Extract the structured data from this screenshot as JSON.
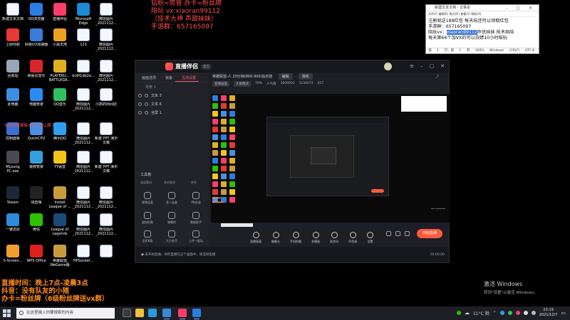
{
  "desktop_icons": [
    {
      "label": "新建文本文档",
      "color": "#ffffff",
      "doc": true
    },
    {
      "label": "QQ浏览器",
      "color": "#2a7de1"
    },
    {
      "label": "直播伴侣",
      "color": "#ff3d6a"
    },
    {
      "label": "Microsoft Edge",
      "color": "#1c8ad6"
    },
    {
      "label": "微信图片_2021112...",
      "color": "#ffffff",
      "doc": true
    },
    {
      "label": "上网导航",
      "color": "#e53935"
    },
    {
      "label": "网易UU加速器",
      "color": "#3b7bd9"
    },
    {
      "label": "小黑无用",
      "color": "#f0a020"
    },
    {
      "label": "123",
      "color": "#ffffff",
      "doc": true
    },
    {
      "label": "微信图片_2021112...",
      "color": "#ffffff",
      "doc": true
    },
    {
      "label": "回收站",
      "color": "#9aa6b8"
    },
    {
      "label": "网易云音乐",
      "color": "#d8262f"
    },
    {
      "label": "PLAYERU... BATTLEGR...",
      "color": "#e0b020"
    },
    {
      "label": "bc6f1db2e...",
      "color": "#ffffff",
      "doc": true
    },
    {
      "label": "微信图片_2021112...",
      "color": "#ffffff",
      "doc": true
    },
    {
      "label": "此电脑",
      "color": "#3d8ee0"
    },
    {
      "label": "电脑管家",
      "color": "#2a8cf0"
    },
    {
      "label": "QQ音乐",
      "color": "#30c060"
    },
    {
      "label": "微信图片_2021112...",
      "color": "#ffffff",
      "doc": true
    },
    {
      "label": "小抓的周间店",
      "color": "#ffffff",
      "doc": true
    },
    {
      "label": "控制面板",
      "color": "#3b6fd1"
    },
    {
      "label": "QuickCPU",
      "color": "#4a90e2"
    },
    {
      "label": "腾讯QQ",
      "color": "#2fa0f0"
    },
    {
      "label": "微信图片_2021112...",
      "color": "#ffffff",
      "doc": true
    },
    {
      "label": "新建 PPT 演示文稿",
      "color": "#ffffff",
      "doc": true
    },
    {
      "label": "MLoong PC.exe",
      "color": "#4a4a55"
    },
    {
      "label": "装修管家",
      "color": "#33a0e0"
    },
    {
      "label": "YY语音",
      "color": "#f5c518"
    },
    {
      "label": "微信图片_2021112...",
      "color": "#ffffff",
      "doc": true
    },
    {
      "label": "新建 PPT 演示文稿",
      "color": "#ffffff",
      "doc": true
    },
    {
      "label": "Steam",
      "color": "#1b2838"
    },
    {
      "label": "快剪辑",
      "color": "#222222"
    },
    {
      "label": "Install League of ...",
      "color": "#c89b3c"
    },
    {
      "label": "微信图片_2021112...",
      "color": "#ffffff",
      "doc": true
    },
    {
      "label": "微信图片_2021112...",
      "color": "#ffffff",
      "doc": true
    },
    {
      "label": "一键还原",
      "color": "#2d8bd8"
    },
    {
      "label": "微信",
      "color": "#2dc100"
    },
    {
      "label": "League of Legends",
      "color": "#1a4a7a"
    },
    {
      "label": "微信图片_2021112...",
      "color": "#ffffff",
      "doc": true
    },
    {
      "label": "微信图片_2021112...",
      "color": "#ffffff",
      "doc": true
    },
    {
      "label": "S-Screen...",
      "color": "#f0a030"
    },
    {
      "label": "WPS Office",
      "color": "#e02020"
    },
    {
      "label": "英雄联盟WeGame版",
      "color": "#c89b3c"
    },
    {
      "label": "HPSocket...",
      "color": "#ffffff",
      "doc": true
    },
    {
      "label": "",
      "color": "#ffffff",
      "doc": true
    }
  ],
  "overlay_top": [
    "钻粉=房管 办卡=粉丝牌",
    "陪玩 vx:xiaoran99112",
    "（技术大神 声甜妹妹）",
    "手游群：657165097"
  ],
  "side_note": "SVB老哥聚集304：哥让魔了",
  "notepad": {
    "title": "新建文本文档 - 记事本",
    "menu": "文件(F)  编辑(E)  格式(O)  查看(V)  帮助(H)",
    "lines": [
      "注册就送188红包 每天玩还可以领取红包",
      "手游群：657165097",
      "每天第66个加VX的可以白嫖10小时陪玩"
    ],
    "line_vx_pre": "陪玩vx：",
    "line_vx_hl": "xiaoran99112",
    "line_vx_post": "声优妹妹 技术局陪",
    "status": "第 1 行，第 1 列  100%  Windows (CRLF)  UTF-8"
  },
  "app": {
    "name": "直播伴侣",
    "version": "官方",
    "tabs": [
      "画面选项",
      "装备",
      "互动设置"
    ],
    "active_tab": 2,
    "scene_header": "场景 1",
    "scenes": [
      "文本 3",
      "文本 6",
      "全屏 1"
    ],
    "toolbox_title": "工具箱",
    "toolbox_subs": [
      "画面素材",
      "其他素材",
      "更多"
    ],
    "tools": [
      "视频连麦",
      "多人连麦",
      "PK对战",
      "虚拟形象",
      "弹幕库",
      "数据助手",
      "全民K歌",
      "大力金币",
      "上传一起玩"
    ],
    "room_title": "英雄联盟-人 20分钟(800-900)钻石挂",
    "edit_label": "编辑",
    "category": "游戏",
    "bar2": [
      "直播画面",
      "大屏模式",
      "79%",
      "人气值",
      "1600001",
      "1130074",
      "617"
    ],
    "controls": [
      "直播画面",
      "摄像头",
      "手机拍摄",
      "多模画",
      "麦克风",
      "声音调",
      "设置"
    ],
    "live_button": "开始直播",
    "status_left": "● 未开始直播。你的直播在这个画面中，请选择直播",
    "status_right": "00:00:00"
  },
  "overlay_bl": [
    "直播时间：晚上7点-凌晨3点",
    "抖音：没有队友的小猪",
    "办卡=粉丝牌（6级粉丝牌送vx群）"
  ],
  "activate": {
    "title": "激活 Windows",
    "sub": "转到\"设置\"以激活 Windows。"
  },
  "taskbar": {
    "search_placeholder": "在这里输入你要搜索的内容",
    "weather": "11°C 阴",
    "time": "23:19",
    "date": "2021/12/7"
  }
}
